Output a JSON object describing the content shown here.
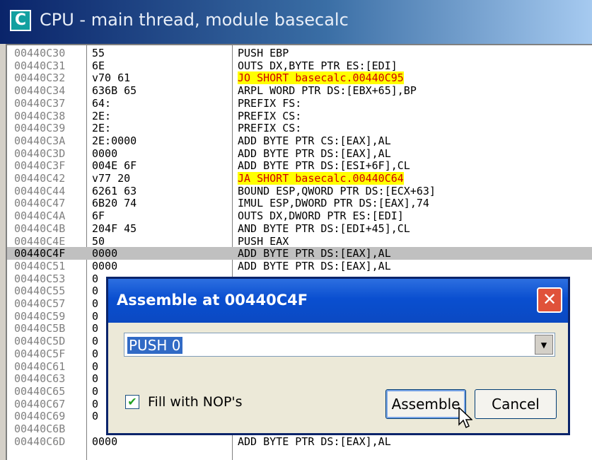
{
  "window": {
    "icon_letter": "C",
    "title": "CPU - main thread, module basecalc"
  },
  "disassembly": [
    {
      "address": "00440C30",
      "hex": "55",
      "instr": "PUSH EBP",
      "jump": false,
      "marker": ""
    },
    {
      "address": "00440C31",
      "hex": "6E",
      "instr": "OUTS DX,BYTE PTR ES:[EDI]",
      "jump": false,
      "marker": ""
    },
    {
      "address": "00440C32",
      "hex": "70 61",
      "instr": "JO SHORT basecalc.00440C95",
      "jump": true,
      "marker": "v"
    },
    {
      "address": "00440C34",
      "hex": "636B 65",
      "instr": "ARPL WORD PTR DS:[EBX+65],BP",
      "jump": false,
      "marker": ""
    },
    {
      "address": "00440C37",
      "hex": "64:",
      "instr": "PREFIX FS:",
      "jump": false,
      "marker": ""
    },
    {
      "address": "00440C38",
      "hex": "2E:",
      "instr": "PREFIX CS:",
      "jump": false,
      "marker": ""
    },
    {
      "address": "00440C39",
      "hex": "2E:",
      "instr": "PREFIX CS:",
      "jump": false,
      "marker": ""
    },
    {
      "address": "00440C3A",
      "hex": "2E:0000",
      "instr": "ADD BYTE PTR CS:[EAX],AL",
      "jump": false,
      "marker": ""
    },
    {
      "address": "00440C3D",
      "hex": "0000",
      "instr": "ADD BYTE PTR DS:[EAX],AL",
      "jump": false,
      "marker": ""
    },
    {
      "address": "00440C3F",
      "hex": "004E 6F",
      "instr": "ADD BYTE PTR DS:[ESI+6F],CL",
      "jump": false,
      "marker": ""
    },
    {
      "address": "00440C42",
      "hex": "77 20",
      "instr": "JA SHORT basecalc.00440C64",
      "jump": true,
      "marker": "v"
    },
    {
      "address": "00440C44",
      "hex": "6261 63",
      "instr": "BOUND ESP,QWORD PTR DS:[ECX+63]",
      "jump": false,
      "marker": ""
    },
    {
      "address": "00440C47",
      "hex": "6B20 74",
      "instr": "IMUL ESP,DWORD PTR DS:[EAX],74",
      "jump": false,
      "marker": ""
    },
    {
      "address": "00440C4A",
      "hex": "6F",
      "instr": "OUTS DX,DWORD PTR ES:[EDI]",
      "jump": false,
      "marker": ""
    },
    {
      "address": "00440C4B",
      "hex": "204F 45",
      "instr": "AND BYTE PTR DS:[EDI+45],CL",
      "jump": false,
      "marker": ""
    },
    {
      "address": "00440C4E",
      "hex": "50",
      "instr": "PUSH EAX",
      "jump": false,
      "marker": ""
    },
    {
      "address": "00440C4F",
      "hex": "0000",
      "instr": "ADD BYTE PTR DS:[EAX],AL",
      "jump": false,
      "marker": "",
      "selected": true
    },
    {
      "address": "00440C51",
      "hex": "0000",
      "instr": "ADD BYTE PTR DS:[EAX],AL",
      "jump": false,
      "marker": ""
    },
    {
      "address": "00440C53",
      "hex": "0",
      "instr": "",
      "jump": false,
      "marker": ""
    },
    {
      "address": "00440C55",
      "hex": "0",
      "instr": "",
      "jump": false,
      "marker": ""
    },
    {
      "address": "00440C57",
      "hex": "0",
      "instr": "",
      "jump": false,
      "marker": ""
    },
    {
      "address": "00440C59",
      "hex": "0",
      "instr": "",
      "jump": false,
      "marker": ""
    },
    {
      "address": "00440C5B",
      "hex": "0",
      "instr": "",
      "jump": false,
      "marker": ""
    },
    {
      "address": "00440C5D",
      "hex": "0",
      "instr": "",
      "jump": false,
      "marker": ""
    },
    {
      "address": "00440C5F",
      "hex": "0",
      "instr": "",
      "jump": false,
      "marker": ""
    },
    {
      "address": "00440C61",
      "hex": "0",
      "instr": "",
      "jump": false,
      "marker": ""
    },
    {
      "address": "00440C63",
      "hex": "0",
      "instr": "",
      "jump": false,
      "marker": ""
    },
    {
      "address": "00440C65",
      "hex": "0",
      "instr": "",
      "jump": false,
      "marker": ""
    },
    {
      "address": "00440C67",
      "hex": "0",
      "instr": "",
      "jump": false,
      "marker": ""
    },
    {
      "address": "00440C69",
      "hex": "0",
      "instr": "",
      "jump": false,
      "marker": ""
    },
    {
      "address": "00440C6B",
      "hex": "",
      "instr": "",
      "jump": false,
      "marker": ""
    },
    {
      "address": "00440C6D",
      "hex": "0000",
      "instr": "ADD BYTE PTR DS:[EAX],AL",
      "jump": false,
      "marker": ""
    }
  ],
  "dialog": {
    "title": "Assemble at 00440C4F",
    "close_glyph": "✕",
    "input_value": "PUSH 0",
    "dropdown_glyph": "▼",
    "checkbox_label": "Fill with NOP's",
    "checkbox_checked": true,
    "checkbox_glyph": "✔",
    "assemble_label": "Assemble",
    "cancel_label": "Cancel"
  },
  "colors": {
    "jump_bg": "#ffff00",
    "jump_text": "#d00000",
    "selection": "#c0c0c0",
    "dialog_title": "#0a4fd0"
  }
}
